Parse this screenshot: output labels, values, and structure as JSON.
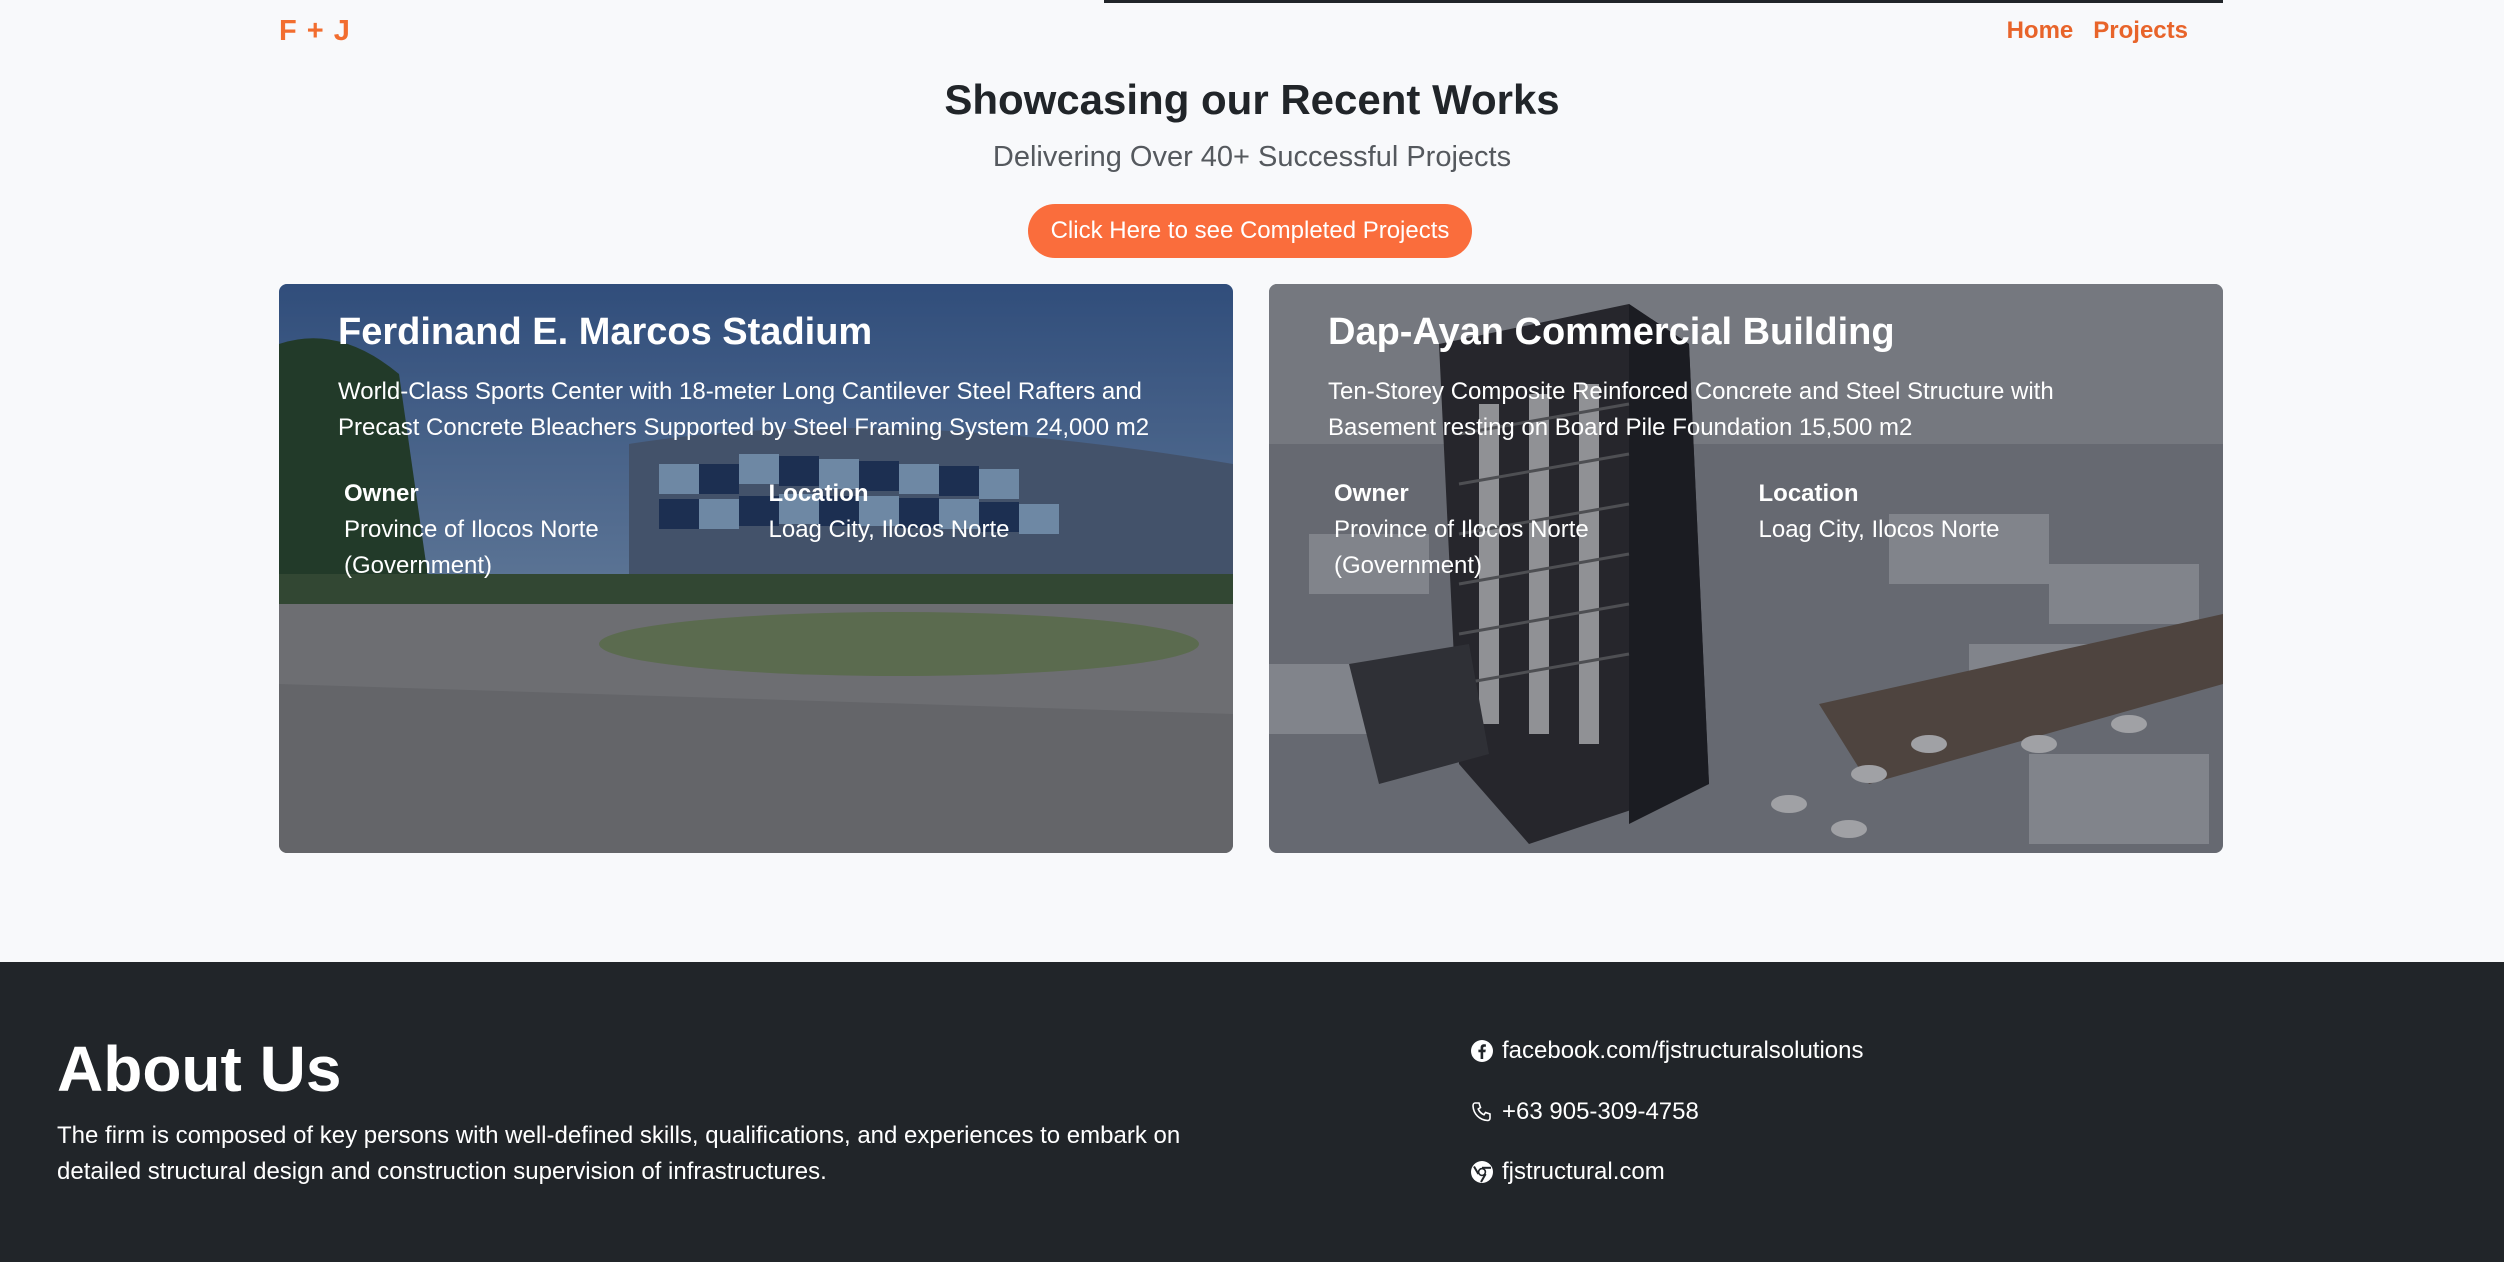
{
  "header": {
    "brand": "F + J",
    "nav": [
      {
        "label": "Home"
      },
      {
        "label": "Projects"
      }
    ]
  },
  "hero": {
    "title": "Showcasing our Recent Works",
    "subtitle": "Delivering Over 40+ Successful Projects",
    "cta_label": "Click Here to see Completed Projects"
  },
  "projects": [
    {
      "title": "Ferdinand E. Marcos Stadium",
      "description": "World-Class Sports Center with 18-meter Long Cantilever Steel Rafters and Precast Concrete Bleachers Supported by Steel Framing System 24,000 m2",
      "owner_label": "Owner",
      "owner": "Province of Ilocos Norte (Government)",
      "location_label": "Location",
      "location": "Loag City, Ilocos Norte"
    },
    {
      "title": "Dap-Ayan Commercial Building",
      "description": "Ten-Storey Composite Reinforced Concrete and Steel Structure with Basement resting on Board Pile Foundation 15,500 m2",
      "owner_label": "Owner",
      "owner": "Province of Ilocos Norte (Government)",
      "location_label": "Location",
      "location": "Loag City, Ilocos Norte"
    }
  ],
  "footer": {
    "about_title": "About Us",
    "about_text": "The firm is composed of key persons with well-defined skills, qualifications, and experiences to embark on detailed structural design and construction supervision of infrastructures.",
    "contacts": [
      {
        "icon": "facebook-icon",
        "text": "facebook.com/fjstructuralsolutions"
      },
      {
        "icon": "phone-icon",
        "text": "+63 905-309-4758"
      },
      {
        "icon": "globe-icon",
        "text": "fjstructural.com"
      }
    ]
  },
  "colors": {
    "accent": "#e8642a",
    "cta": "#fa6d3c",
    "footer_bg": "#212529",
    "page_bg": "#f8f9fb"
  }
}
